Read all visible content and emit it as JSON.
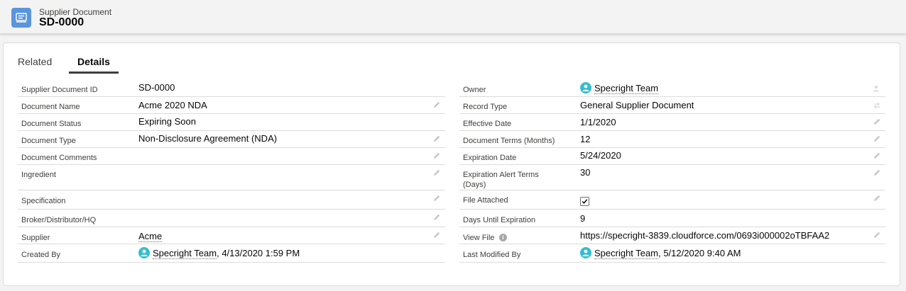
{
  "header": {
    "object_type": "Supplier Document",
    "record_name": "SD-0000"
  },
  "tabs": [
    {
      "label": "Related"
    },
    {
      "label": "Details"
    }
  ],
  "left_fields": {
    "supplier_document_id": {
      "label": "Supplier Document ID",
      "value": "SD-0000"
    },
    "document_name": {
      "label": "Document Name",
      "value": "Acme 2020 NDA"
    },
    "document_status": {
      "label": "Document Status",
      "value": "Expiring Soon"
    },
    "document_type": {
      "label": "Document Type",
      "value": "Non-Disclosure Agreement (NDA)"
    },
    "document_comments": {
      "label": "Document Comments",
      "value": ""
    },
    "ingredient": {
      "label": "Ingredient",
      "value": ""
    },
    "specification": {
      "label": "Specification",
      "value": ""
    },
    "broker": {
      "label": "Broker/Distributor/HQ",
      "value": ""
    },
    "supplier": {
      "label": "Supplier",
      "value": "Acme"
    },
    "created_by": {
      "label": "Created By",
      "user": "Specright Team",
      "date": ", 4/13/2020 1:59 PM"
    }
  },
  "right_fields": {
    "owner": {
      "label": "Owner",
      "user": "Specright Team"
    },
    "record_type": {
      "label": "Record Type",
      "value": "General Supplier Document"
    },
    "effective_date": {
      "label": "Effective Date",
      "value": "1/1/2020"
    },
    "document_terms": {
      "label": "Document Terms (Months)",
      "value": "12"
    },
    "expiration_date": {
      "label": "Expiration Date",
      "value": "5/24/2020"
    },
    "expiration_alert": {
      "label_line1": "Expiration Alert Terms",
      "label_line2": "(Days)",
      "value": "30"
    },
    "file_attached": {
      "label": "File Attached",
      "checked": true
    },
    "days_until_expiration": {
      "label": "Days Until Expiration",
      "value": "9"
    },
    "view_file": {
      "label": "View File",
      "value": "https://specright-3839.cloudforce.com/0693i000002oTBFAA2"
    },
    "last_modified_by": {
      "label": "Last Modified By",
      "user": "Specright Team",
      "date": ", 5/12/2020 9:40 AM"
    }
  },
  "colors": {
    "object_icon": "#5a95dd",
    "avatar": "#34becd",
    "border": "#dddbda"
  }
}
